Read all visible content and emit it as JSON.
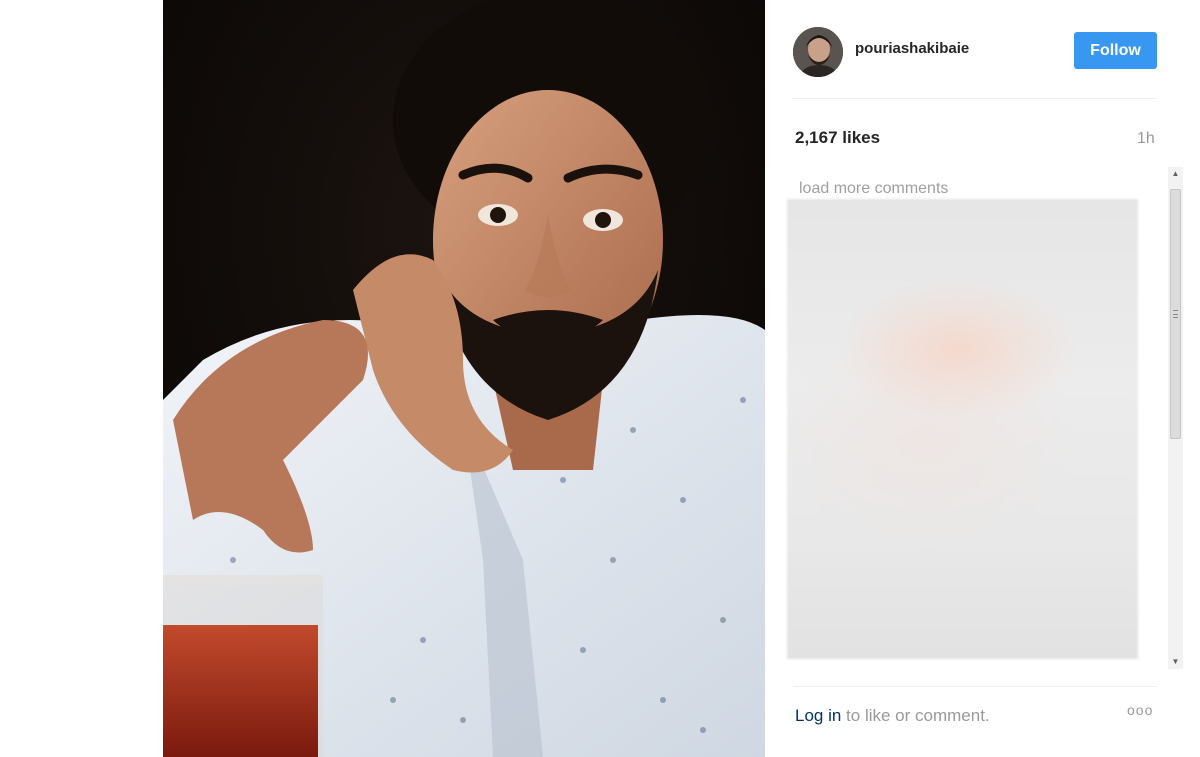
{
  "post": {
    "username": "pouriashakibaie",
    "follow_label": "Follow",
    "likes": "2,167 likes",
    "time": "1h",
    "load_more": "load more comments",
    "login_link": "Log in",
    "login_rest": " to like or comment.",
    "more_dots": "ooo"
  },
  "icons": {
    "more": "more-options-icon",
    "scroll_up": "scroll-up-arrow-icon",
    "scroll_down": "scroll-down-arrow-icon"
  },
  "colors": {
    "follow_button": "#3897f0",
    "login_link": "#003569",
    "muted_text": "#999999",
    "primary_text": "#262626"
  }
}
